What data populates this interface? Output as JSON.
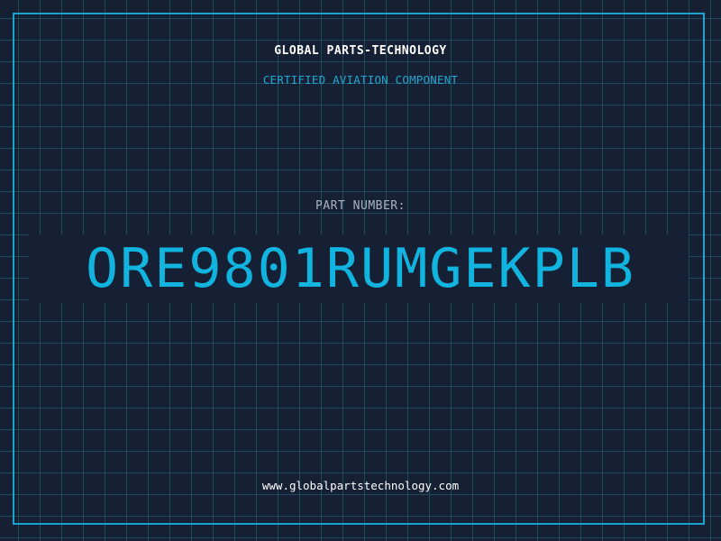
{
  "header": {
    "company": "GLOBAL PARTS-TECHNOLOGY",
    "subtitle": "CERTIFIED AVIATION COMPONENT"
  },
  "part": {
    "label": "PART NUMBER:",
    "number": "ORE9801RUMGEKPLB"
  },
  "footer": {
    "website": "www.globalpartstechnology.com"
  },
  "colors": {
    "background": "#162035",
    "grid": "#1f4a5e",
    "accent": "#10b4de",
    "text": "#ffffff"
  }
}
